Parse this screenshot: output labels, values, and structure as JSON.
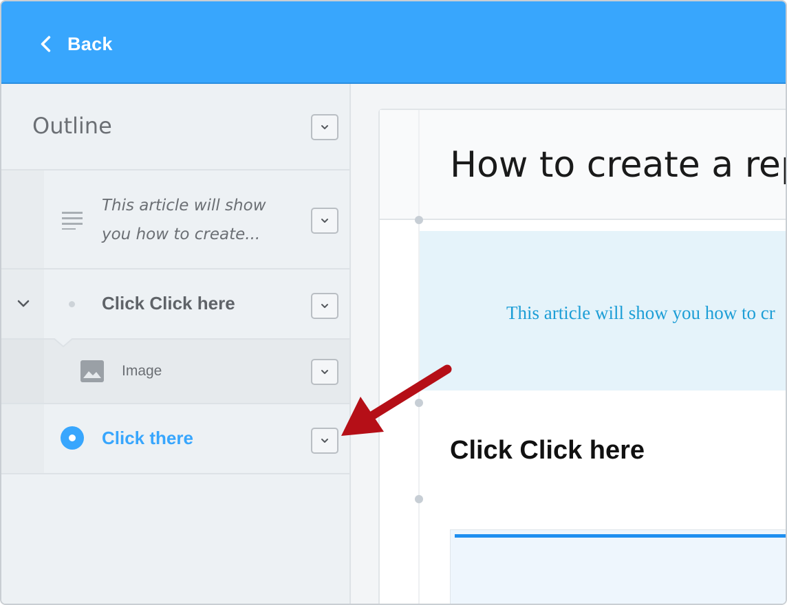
{
  "header": {
    "back_label": "Back"
  },
  "sidebar": {
    "title": "Outline",
    "items": [
      {
        "label": "This article will show you how to create...",
        "type": "text"
      },
      {
        "label": "Click Click here",
        "type": "step"
      },
      {
        "label": "Image",
        "type": "image"
      },
      {
        "label": "Click there",
        "type": "step-active"
      }
    ]
  },
  "main": {
    "page_title": "How to create a repo",
    "intro": "This article will show you how to cr",
    "section_heading": "Click Click here"
  },
  "colors": {
    "accent": "#38a6fd",
    "intro_text": "#1d9ed6",
    "arrow": "#b50f17"
  },
  "icons": {
    "back": "chevron-left-icon",
    "dropdown": "chevron-down-icon",
    "text": "text-lines-icon",
    "image": "image-icon",
    "active": "radio-dot-icon"
  }
}
